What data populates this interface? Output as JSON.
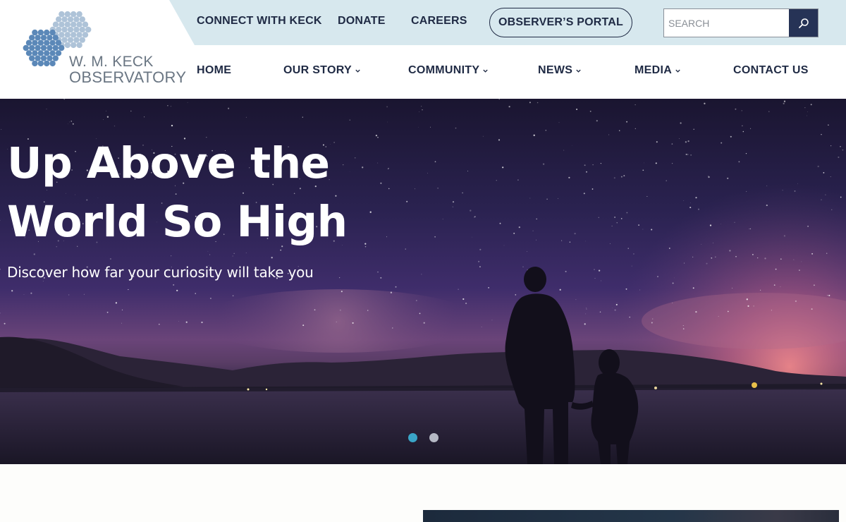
{
  "logo": {
    "line1": "W. M. KECK",
    "line2": "OBSERVATORY"
  },
  "utility": {
    "connect": "CONNECT WITH KECK",
    "donate": "DONATE",
    "careers": "CAREERS",
    "portal": "OBSERVER’S PORTAL"
  },
  "search": {
    "placeholder": "SEARCH",
    "value": ""
  },
  "nav": {
    "home": "HOME",
    "story": "OUR STORY",
    "community": "COMMUNITY",
    "news": "NEWS",
    "media": "MEDIA",
    "contact": "CONTACT US"
  },
  "hero": {
    "title_line1": "Up Above the",
    "title_line2": "World So High",
    "subtitle": "Discover how far your curiosity will take you"
  },
  "colors": {
    "navy": "#1f2a44",
    "topbar": "#d7e8ee",
    "accent": "#3aa5c7"
  },
  "icons": {
    "search": "magnifier-icon",
    "dropdown": "chevron-down-icon",
    "logo": "hexagon-mirror-logo"
  }
}
